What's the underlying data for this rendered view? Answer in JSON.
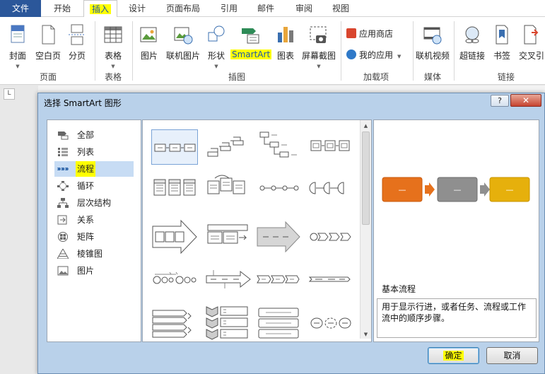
{
  "tabs": [
    {
      "id": "file",
      "label": "文件"
    },
    {
      "id": "home",
      "label": "开始"
    },
    {
      "id": "insert",
      "label": "插入"
    },
    {
      "id": "design",
      "label": "设计"
    },
    {
      "id": "layout",
      "label": "页面布局"
    },
    {
      "id": "refs",
      "label": "引用"
    },
    {
      "id": "mail",
      "label": "邮件"
    },
    {
      "id": "review",
      "label": "审阅"
    },
    {
      "id": "view",
      "label": "视图"
    }
  ],
  "ribbon": {
    "pages": {
      "cover": "封面",
      "blank": "空白页",
      "break": "分页",
      "group": "页面"
    },
    "tables": {
      "table": "表格",
      "group": "表格"
    },
    "illustrations": {
      "picture": "图片",
      "online_picture": "联机图片",
      "shapes": "形状",
      "smartart": "SmartArt",
      "chart": "图表",
      "screenshot": "屏幕截图",
      "group": "插图"
    },
    "addins": {
      "store": "应用商店",
      "my_apps": "我的应用",
      "group": "加载项"
    },
    "media": {
      "online_video": "联机视频",
      "group": "媒体"
    },
    "links": {
      "hyperlink": "超链接",
      "bookmark": "书签",
      "crossref": "交叉引",
      "group": "链接"
    }
  },
  "dialog": {
    "title": "选择 SmartArt 图形",
    "help": "?",
    "close": "✕",
    "categories": [
      {
        "label": "全部",
        "icon": "all-icon"
      },
      {
        "label": "列表",
        "icon": "list-icon"
      },
      {
        "label": "流程",
        "icon": "process-icon"
      },
      {
        "label": "循环",
        "icon": "cycle-icon"
      },
      {
        "label": "层次结构",
        "icon": "hierarchy-icon"
      },
      {
        "label": "关系",
        "icon": "relationship-icon"
      },
      {
        "label": "矩阵",
        "icon": "matrix-icon"
      },
      {
        "label": "棱锥图",
        "icon": "pyramid-icon"
      },
      {
        "label": "图片",
        "icon": "picture-icon"
      }
    ],
    "selected_category": "流程",
    "preview": {
      "box_dash": "—",
      "colors": [
        "#e6711c",
        "#8f8f8f",
        "#e6b00c"
      ]
    },
    "description_title": "基本流程",
    "description": "用于显示行进，或者任务、流程或工作流中的顺序步骤。",
    "ok": "确定",
    "cancel": "取消"
  },
  "colors": {
    "file_tab": "#2b579a",
    "highlight": "#ffff00",
    "dialog_frame": "#b9d1ea",
    "selection": "#c7dcf4"
  }
}
